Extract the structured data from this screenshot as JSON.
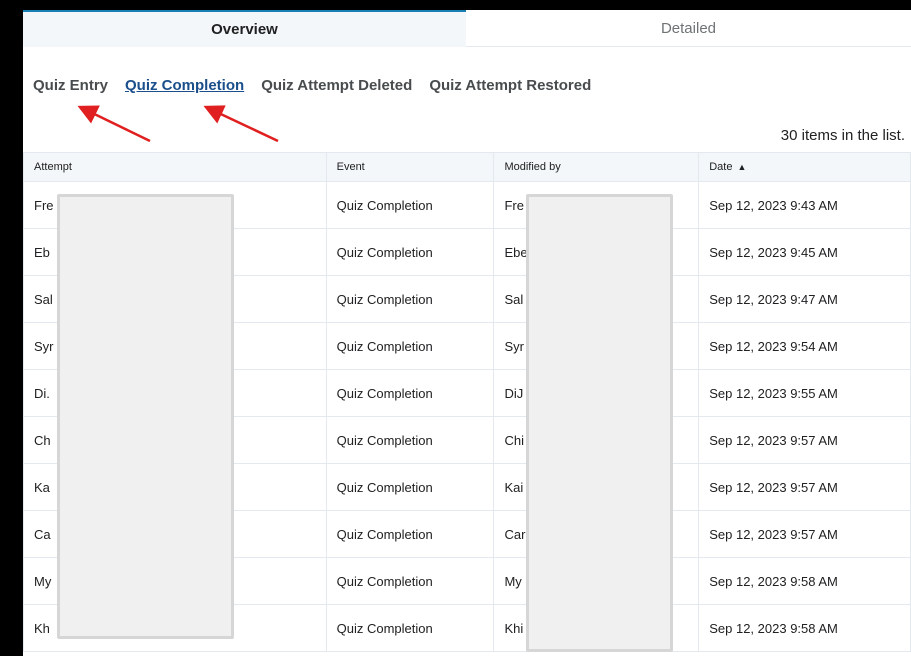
{
  "tabs": {
    "overview": "Overview",
    "detailed": "Detailed"
  },
  "sublinks": [
    "Quiz Entry",
    "Quiz Completion",
    "Quiz Attempt Deleted",
    "Quiz Attempt Restored"
  ],
  "count_text": "30 items in the list.",
  "table": {
    "headers": {
      "attempt": "Attempt",
      "event": "Event",
      "modified_by": "Modified by",
      "date": "Date"
    },
    "sort_indicator": "▲",
    "rows": [
      {
        "attempt": "Fre",
        "event": "Quiz Completion",
        "modified_by": "Fre",
        "date": "Sep 12, 2023 9:43 AM"
      },
      {
        "attempt": "Eb",
        "event": "Quiz Completion",
        "modified_by": "Ebe",
        "date": "Sep 12, 2023 9:45 AM"
      },
      {
        "attempt": "Sal",
        "event": "Quiz Completion",
        "modified_by": "Sal",
        "date": "Sep 12, 2023 9:47 AM"
      },
      {
        "attempt": "Syr",
        "event": "Quiz Completion",
        "modified_by": "Syr",
        "date": "Sep 12, 2023 9:54 AM"
      },
      {
        "attempt": "Di.",
        "event": "Quiz Completion",
        "modified_by": "DiJ",
        "date": "Sep 12, 2023 9:55 AM"
      },
      {
        "attempt": "Ch",
        "event": "Quiz Completion",
        "modified_by": "Chi",
        "date": "Sep 12, 2023 9:57 AM"
      },
      {
        "attempt": "Ka",
        "event": "Quiz Completion",
        "modified_by": "Kai",
        "date": "Sep 12, 2023 9:57 AM"
      },
      {
        "attempt": "Ca",
        "event": "Quiz Completion",
        "modified_by": "Car",
        "date": "Sep 12, 2023 9:57 AM"
      },
      {
        "attempt": "My",
        "event": "Quiz Completion",
        "modified_by": "My",
        "date": "Sep 12, 2023 9:58 AM"
      },
      {
        "attempt": "Kh",
        "event": "Quiz Completion",
        "modified_by": "Khi",
        "date": "Sep 12, 2023 9:58 AM"
      }
    ]
  },
  "colors": {
    "annotation_arrow": "#e02020",
    "link_active": "#1a4f8b",
    "tab_border": "#1a7fb3"
  }
}
